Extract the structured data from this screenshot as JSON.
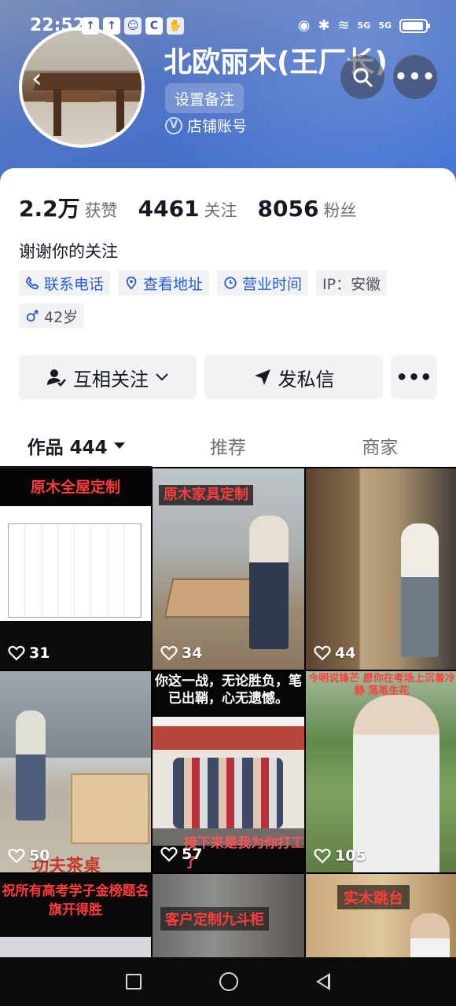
{
  "status_bar": {
    "time": "22:52",
    "network": "5G",
    "network2": "5G"
  },
  "profile": {
    "name": "北欧丽木(王厂长)",
    "remark_button": "设置备注",
    "account_type": "店铺账号",
    "stats": [
      {
        "value": "2.2万",
        "label": "获赞"
      },
      {
        "value": "4461",
        "label": "关注"
      },
      {
        "value": "8056",
        "label": "粉丝"
      }
    ],
    "bio": "谢谢你的关注",
    "tags": [
      {
        "label": "联系电话",
        "icon": "phone-icon"
      },
      {
        "label": "查看地址",
        "icon": "location-icon"
      },
      {
        "label": "营业时间",
        "icon": "clock-icon"
      },
      {
        "label": "IP：安徽",
        "icon": ""
      },
      {
        "label": "42岁",
        "icon": "male-icon"
      }
    ]
  },
  "actions": {
    "follow": "互相关注",
    "message": "发私信"
  },
  "tabs": [
    {
      "label": "作品 444",
      "active": true
    },
    {
      "label": "推荐",
      "active": false
    },
    {
      "label": "商家",
      "active": false
    }
  ],
  "videos": [
    {
      "title": "原木全屋定制",
      "likes": "31"
    },
    {
      "title": "原木家具定制",
      "likes": "34"
    },
    {
      "title": "",
      "likes": "44"
    },
    {
      "title": "功夫茶桌",
      "likes": "50"
    },
    {
      "title": "你这一战，无论胜负，笔已出鞘，心无遗憾。",
      "caption": "接下来是我为你打工了",
      "likes": "57"
    },
    {
      "title": "今明说锋芒 愿你在考场上沉着冷静 落笔生花",
      "likes": "105"
    },
    {
      "title": "祝所有高考学子金榜题名旗开得胜",
      "likes": ""
    },
    {
      "title": "客户定制九斗柜",
      "likes": ""
    },
    {
      "title": "实木跳台",
      "likes": ""
    }
  ],
  "colors": {
    "header_gradient_start": "#7c8fb8",
    "header_gradient_end": "#3a6fd6",
    "tag_blue": "#2a5ad6",
    "overlay_red": "#ff3b3b"
  }
}
